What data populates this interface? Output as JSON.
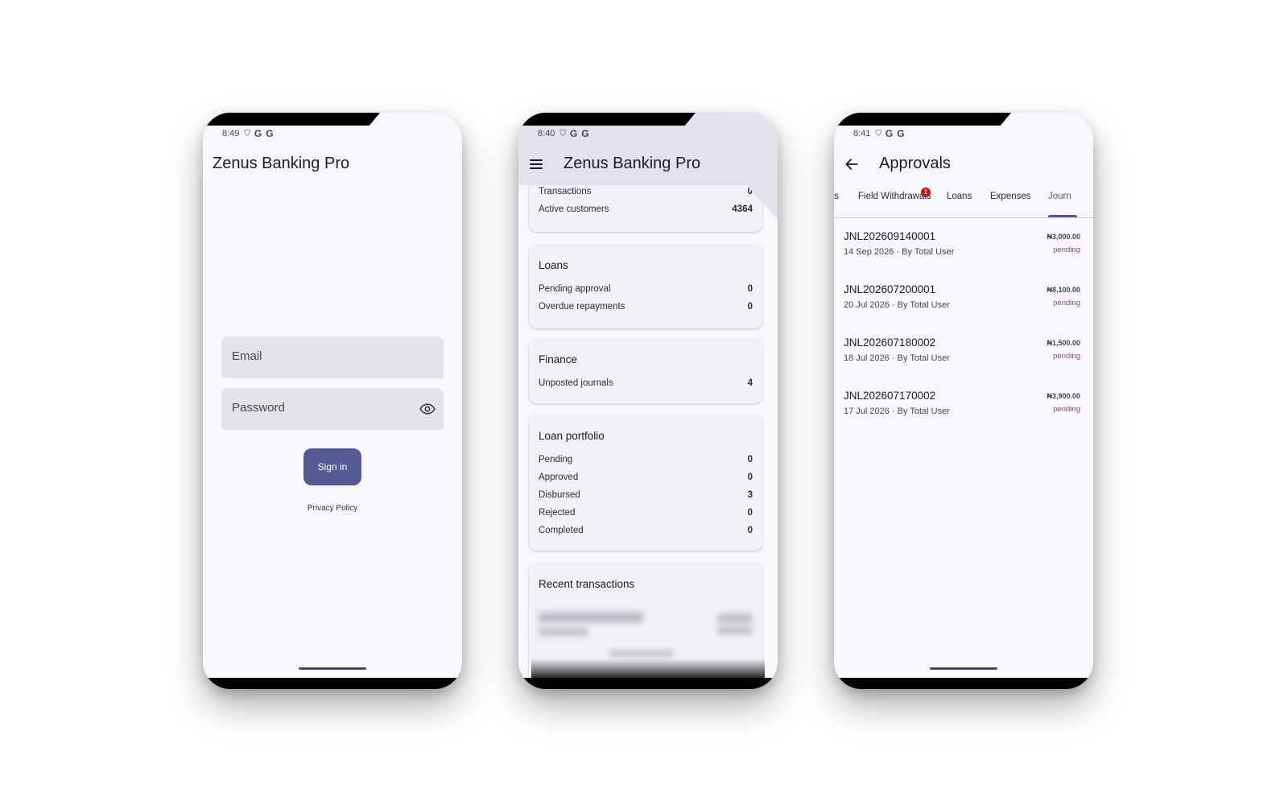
{
  "login": {
    "status_time": "8:49",
    "app_title": "Zenus Banking Pro",
    "email_placeholder": "Email",
    "password_placeholder": "Password",
    "sign_in_label": "Sign in",
    "privacy_link": "Privacy Policy"
  },
  "dashboard": {
    "status_time": "8:40",
    "app_title": "Zenus Banking Pro",
    "overview": {
      "rows": [
        {
          "label": "Transactions",
          "value": "0"
        },
        {
          "label": "Active customers",
          "value": "4364"
        }
      ]
    },
    "loans": {
      "title": "Loans",
      "rows": [
        {
          "label": "Pending approval",
          "value": "0"
        },
        {
          "label": "Overdue repayments",
          "value": "0"
        }
      ]
    },
    "finance": {
      "title": "Finance",
      "rows": [
        {
          "label": "Unposted journals",
          "value": "4"
        }
      ]
    },
    "portfolio": {
      "title": "Loan portfolio",
      "rows": [
        {
          "label": "Pending",
          "value": "0"
        },
        {
          "label": "Approved",
          "value": "0"
        },
        {
          "label": "Disbursed",
          "value": "3"
        },
        {
          "label": "Rejected",
          "value": "0"
        },
        {
          "label": "Completed",
          "value": "0"
        }
      ]
    },
    "recent": {
      "title": "Recent transactions"
    }
  },
  "approvals": {
    "status_time": "8:41",
    "app_title": "Approvals",
    "tabs": [
      {
        "label": "s"
      },
      {
        "label": "Field Withdrawals"
      },
      {
        "label": "Loans"
      },
      {
        "label": "Expenses"
      },
      {
        "label": "Journ"
      }
    ],
    "badge_count": "1",
    "journals": [
      {
        "id": "JNL202609140001",
        "meta": "14 Sep 2026 · By Total User",
        "amount": "₦3,000.00",
        "status": "pending"
      },
      {
        "id": "JNL202607200001",
        "meta": "20 Jul 2026 · By Total User",
        "amount": "₦8,100.00",
        "status": "pending"
      },
      {
        "id": "JNL202607180002",
        "meta": "18 Jul 2026 · By Total User",
        "amount": "₦1,500.00",
        "status": "pending"
      },
      {
        "id": "JNL202607170002",
        "meta": "17 Jul 2026 · By Total User",
        "amount": "₦3,900.00",
        "status": "pending"
      }
    ]
  },
  "colors": {
    "primary": "#545a92",
    "surface": "#f9f7fd",
    "field_bg": "#e4e1e9",
    "badge": "#ba1a1a",
    "pending": "#7d5260"
  }
}
